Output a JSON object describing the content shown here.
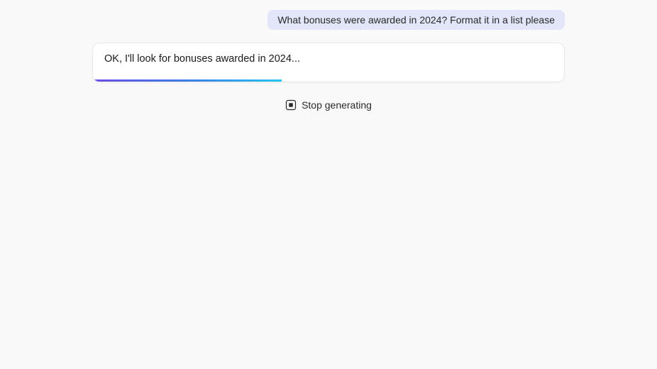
{
  "user_message": {
    "text": "What bonuses were awarded in 2024? Format it in a list please"
  },
  "assistant_message": {
    "text": "OK, I'll look for bonuses awarded in 2024..."
  },
  "controls": {
    "stop_label": "Stop generating"
  }
}
